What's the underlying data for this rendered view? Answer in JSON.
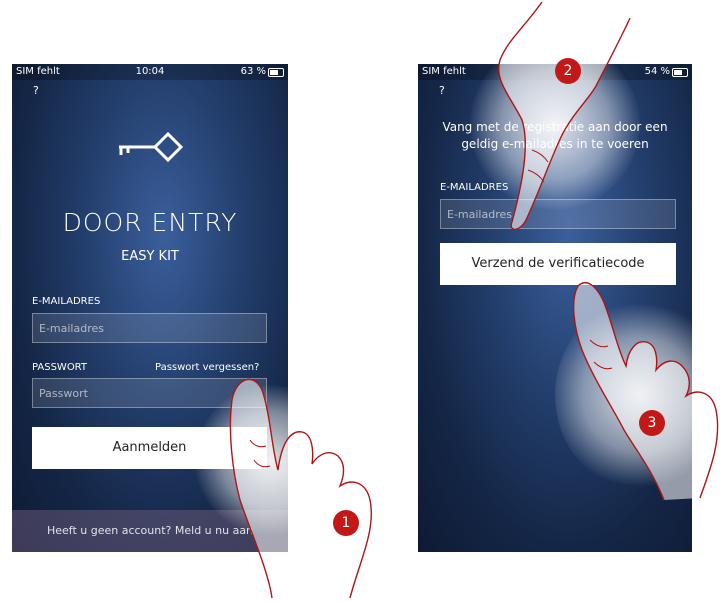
{
  "left_screen": {
    "status": {
      "carrier": "SIM fehlt",
      "time": "10:04",
      "battery": "63 %"
    },
    "help": "?",
    "title": "DOOR ENTRY",
    "subtitle": "EASY KIT",
    "email_label": "E-MAILADRES",
    "email_placeholder": "E-mailadres",
    "password_label": "PASSWORT",
    "forgot_link": "Passwort vergessen?",
    "password_placeholder": "Passwort",
    "login_button": "Aanmelden",
    "footer": "Heeft u geen account? Meld u nu aan"
  },
  "right_screen": {
    "status": {
      "carrier": "SIM fehlt",
      "time": "",
      "battery": "54 %"
    },
    "help": "?",
    "intro_line1": "Vang met de registratie aan door een",
    "intro_line2": "geldig e-mailadres in te voeren",
    "email_label": "E-MAILADRES",
    "email_placeholder": "E-mailadres",
    "send_button": "Verzend de verificatiecode"
  },
  "steps": {
    "one": "1",
    "two": "2",
    "three": "3"
  },
  "colors": {
    "badge": "#c21818",
    "hand_outline": "#b01515"
  }
}
